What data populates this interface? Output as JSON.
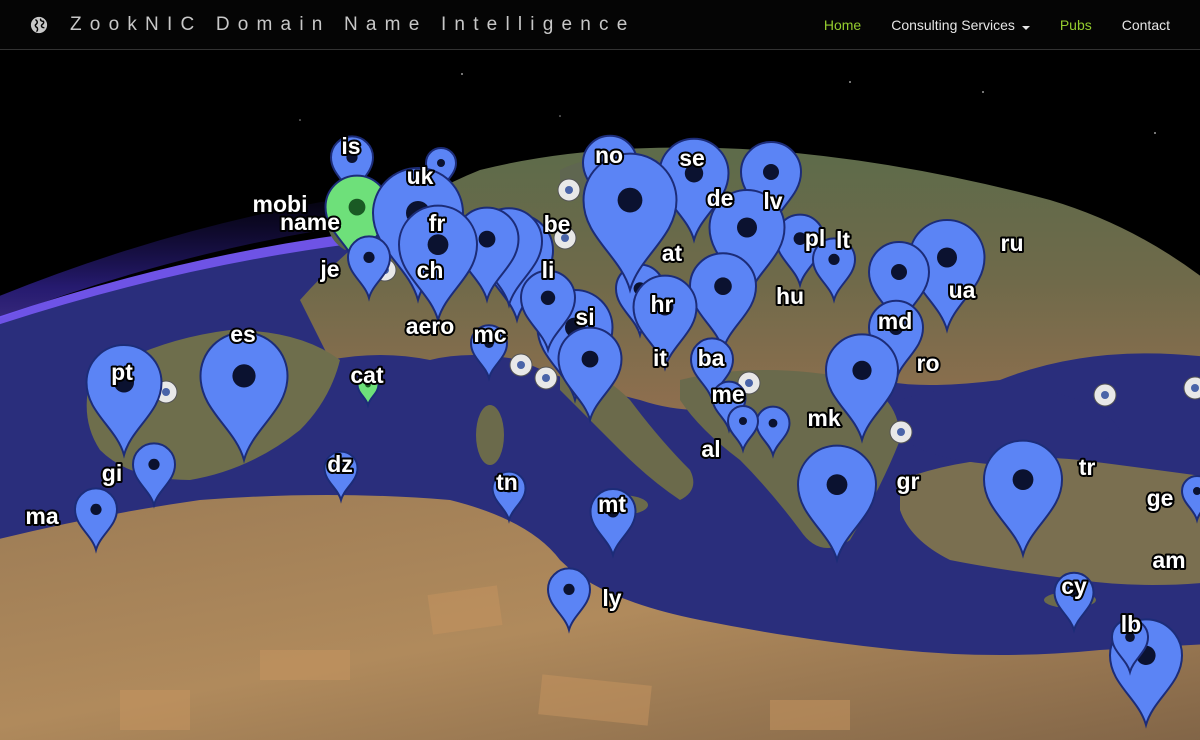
{
  "navbar": {
    "brand": "ZookNIC Domain Name Intelligence",
    "brand_icon": "globe-icon",
    "items": [
      {
        "label": "Home",
        "color": "#94cc2e"
      },
      {
        "label": "Consulting Services",
        "color": "#e6e6e6",
        "dropdown": true
      },
      {
        "label": "Pubs",
        "color": "#94cc2e"
      },
      {
        "label": "Contact",
        "color": "#e6e6e6"
      }
    ]
  },
  "colors": {
    "marker_blue": "#5b84f5",
    "marker_green": "#6ee07a",
    "sea": "#2a2e7c",
    "atmosphere": "#6a4bff"
  },
  "map": {
    "markers": [
      "is",
      "uk",
      "mobi",
      "name",
      "fr",
      "be",
      "no",
      "se",
      "de",
      "lv",
      "ru",
      "pl",
      "lt",
      "je",
      "ch",
      "li",
      "at",
      "hu",
      "ua",
      "hr",
      "si",
      "aero",
      "mc",
      "md",
      "es",
      "cat",
      "it",
      "ba",
      "ro",
      "pt",
      "me",
      "mk",
      "al",
      "gi",
      "dz",
      "tn",
      "mt",
      "gr",
      "tr",
      "ge",
      "ma",
      "am",
      "ly",
      "cy",
      "lb"
    ]
  }
}
